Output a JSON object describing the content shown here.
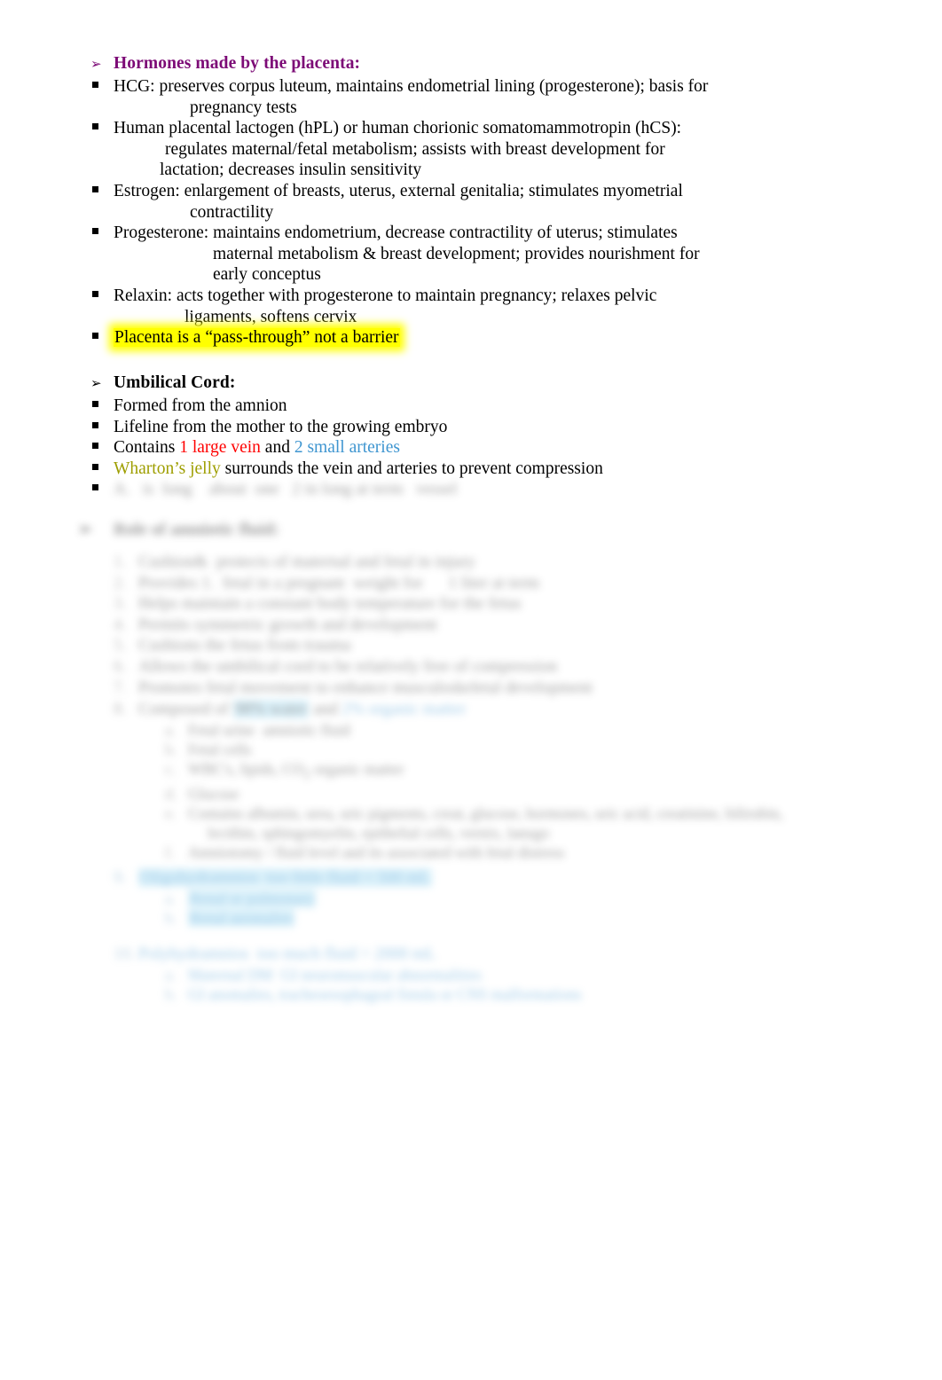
{
  "document": {
    "type": "study-notes",
    "page_background": "#FFFFFF",
    "colors": {
      "heading_purple": "#7C0A76",
      "accent_red": "#FF0000",
      "accent_blue": "#3E95D0",
      "accent_olive": "#9E9E00",
      "highlight_yellow": "#FFFF00",
      "highlight_cyan": "#B4E2F5",
      "body_black": "#000000"
    },
    "markers": {
      "level1": "➢",
      "level2": "▪"
    }
  },
  "sections": [
    {
      "id": "hormones",
      "heading": "Hormones made by the placenta:",
      "heading_color": "#7C0A76",
      "bullets": [
        {
          "id": "hcg",
          "lines": [
            "HCG: preserves corpus luteum, maintains endometrial lining (progesterone); basis for",
            "pregnancy tests"
          ]
        },
        {
          "id": "hpl",
          "lines": [
            "Human placental lactogen (hPL) or human chorionic somatomammotropin (hCS):",
            "regulates maternal/fetal metabolism; assists with breast development for",
            "lactation; decreases insulin sensitivity"
          ]
        },
        {
          "id": "estrogen",
          "lines": [
            "Estrogen: enlargement of breasts, uterus, external genitalia; stimulates myometrial",
            "contractility"
          ]
        },
        {
          "id": "progesterone",
          "lines": [
            "Progesterone: maintains endometrium, decrease contractility of uterus; stimulates",
            "maternal metabolism & breast development; provides nourishment for",
            "early conceptus"
          ]
        },
        {
          "id": "relaxin",
          "lines": [
            "Relaxin: acts together with progesterone to maintain pregnancy; relaxes pelvic",
            "ligaments, softens cervix"
          ]
        },
        {
          "id": "pass-through",
          "highlighted": true,
          "highlight_color": "#FFFF00",
          "lines": [
            "Placenta is a “pass-through” not a barrier"
          ]
        }
      ]
    },
    {
      "id": "umbilical-cord",
      "heading": "Umbilical Cord:",
      "heading_color": "#000000",
      "bullets": [
        {
          "id": "formed",
          "text": "Formed from the amnion"
        },
        {
          "id": "lifeline",
          "text": "Lifeline from the mother to the growing embryo"
        },
        {
          "id": "contains",
          "segments": [
            {
              "text": "Contains ",
              "color": "#000000"
            },
            {
              "text": "1 large vein",
              "color": "#FF0000"
            },
            {
              "text": " and ",
              "color": "#000000"
            },
            {
              "text": "2 small arteries",
              "color": "#3E95D0"
            }
          ]
        },
        {
          "id": "whartons-jelly",
          "segments": [
            {
              "text": "Wharton’s jelly",
              "color": "#9E9E00"
            },
            {
              "text": " surrounds the vein and arteries to prevent compression",
              "color": "#000000"
            }
          ]
        },
        {
          "id": "cord-last",
          "blurred": true,
          "text": ""
        }
      ]
    },
    {
      "id": "redacted-section",
      "blurred": true,
      "note": "Lower portion of page is blurred and illegible",
      "heading": "",
      "lines": [
        {
          "indent": 1,
          "marker": "",
          "text": "",
          "style": "dark"
        },
        {
          "indent": 1,
          "marker": "",
          "text": "",
          "style": "dark"
        },
        {
          "indent": 1,
          "marker": "",
          "text": "",
          "style": "dark"
        },
        {
          "indent": 1,
          "marker": "",
          "text": "",
          "style": "dark"
        },
        {
          "indent": 1,
          "marker": "",
          "text": "",
          "style": "dark"
        },
        {
          "indent": 1,
          "marker": "",
          "text": "",
          "style": "dark"
        },
        {
          "indent": 1,
          "marker": "",
          "text": "",
          "style": "dark"
        },
        {
          "indent": 1,
          "marker": "",
          "text": "",
          "style": "cyan-highlight"
        },
        {
          "indent": 2,
          "marker": "",
          "text": "",
          "style": "dark"
        },
        {
          "indent": 2,
          "marker": "",
          "text": "",
          "style": "dark"
        },
        {
          "indent": 2,
          "marker": "",
          "text": "",
          "style": "dark"
        },
        {
          "indent": 2,
          "marker": "",
          "text": "",
          "style": "dark"
        },
        {
          "indent": 2,
          "marker": "",
          "text": "",
          "style": "dark"
        },
        {
          "indent": 2,
          "marker": "",
          "text": "",
          "style": "dark"
        },
        {
          "indent": 1,
          "marker": "",
          "text": "",
          "style": "cyan-highlight"
        },
        {
          "indent": 2,
          "marker": "",
          "text": "",
          "style": "cyan-highlight"
        },
        {
          "indent": 2,
          "marker": "",
          "text": "",
          "style": "cyan-highlight"
        },
        {
          "indent": 1,
          "marker": "",
          "text": "",
          "style": "blue"
        },
        {
          "indent": 2,
          "marker": "",
          "text": "",
          "style": "blue"
        },
        {
          "indent": 2,
          "marker": "",
          "text": "",
          "style": "blue"
        }
      ]
    }
  ]
}
